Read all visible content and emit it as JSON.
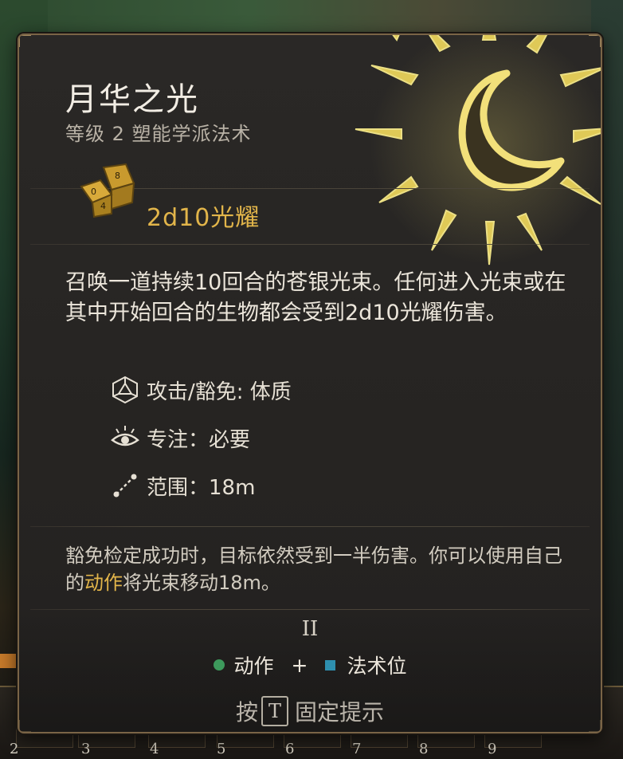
{
  "spell": {
    "name": "月华之光",
    "level_school": "等级 2 塑能学派法术",
    "damage": "2d10光耀",
    "description": "召唤一道持续10回合的苍银光束。任何进入光束或在其中开始回合的生物都会受到2d10光耀伤害。",
    "properties": [
      {
        "icon": "d20-icon",
        "text": "攻击/豁免: 体质"
      },
      {
        "icon": "concentration-eye-icon",
        "text": "专注：必要"
      },
      {
        "icon": "range-icon",
        "text": "范围：18m"
      }
    ],
    "note_prefix": "豁免检定成功时，目标依然受到一半伤害。你可以使用自己的",
    "note_highlight": "动作",
    "note_suffix": "将光束移动18m。",
    "spell_slot_level": "II",
    "costs": {
      "action": "动作",
      "plus": "+",
      "spell_slot": "法术位"
    },
    "pin_hint": {
      "prefix": "按",
      "key": "T",
      "suffix": "固定提示"
    }
  },
  "hotbar": {
    "numbers": [
      "2",
      "3",
      "4",
      "5",
      "6",
      "7",
      "8",
      "9"
    ]
  },
  "colors": {
    "accent_gold": "#e2b54a",
    "panel_border": "#7a6446",
    "action_green": "#3d9a5c",
    "spell_slot_blue": "#2e8fae"
  }
}
